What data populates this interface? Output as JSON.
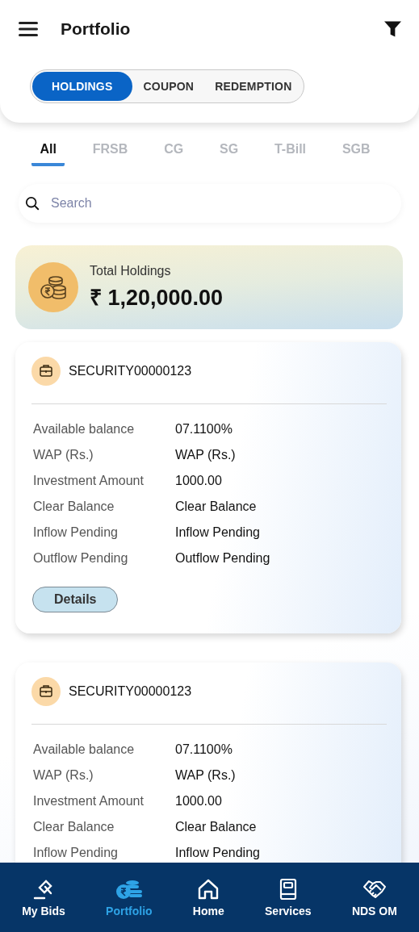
{
  "header": {
    "title": "Portfolio"
  },
  "segments": [
    {
      "label": "HOLDINGS",
      "selected": true
    },
    {
      "label": "COUPON",
      "selected": false
    },
    {
      "label": "REDEMPTION",
      "selected": false
    }
  ],
  "tabs": [
    {
      "label": "All",
      "selected": true
    },
    {
      "label": "FRSB",
      "selected": false
    },
    {
      "label": "CG",
      "selected": false
    },
    {
      "label": "SG",
      "selected": false
    },
    {
      "label": "T-Bill",
      "selected": false
    },
    {
      "label": "SGB",
      "selected": false
    }
  ],
  "search": {
    "placeholder": "Search"
  },
  "total": {
    "label": "Total Holdings",
    "amount": "₹ 1,20,000.00"
  },
  "cards": [
    {
      "title": "SECURITY00000123",
      "rows": [
        {
          "label": "Available balance",
          "value": "07.1100%"
        },
        {
          "label": "WAP (Rs.)",
          "value": "WAP (Rs.)"
        },
        {
          "label": "Investment Amount",
          "value": "1000.00"
        },
        {
          "label": "Clear Balance",
          "value": "Clear Balance"
        },
        {
          "label": "Inflow Pending",
          "value": "Inflow Pending"
        },
        {
          "label": "Outflow Pending",
          "value": "Outflow Pending"
        }
      ],
      "button": "Details"
    },
    {
      "title": "SECURITY00000123",
      "rows": [
        {
          "label": "Available balance",
          "value": "07.1100%"
        },
        {
          "label": "WAP (Rs.)",
          "value": "WAP (Rs.)"
        },
        {
          "label": "Investment Amount",
          "value": "1000.00"
        },
        {
          "label": "Clear Balance",
          "value": "Clear Balance"
        },
        {
          "label": "Inflow Pending",
          "value": "Inflow Pending"
        }
      ]
    }
  ],
  "nav": [
    {
      "label": "My Bids",
      "selected": false
    },
    {
      "label": "Portfolio",
      "selected": true
    },
    {
      "label": "Home",
      "selected": false
    },
    {
      "label": "Services",
      "selected": false
    },
    {
      "label": "NDS OM",
      "selected": false
    }
  ]
}
